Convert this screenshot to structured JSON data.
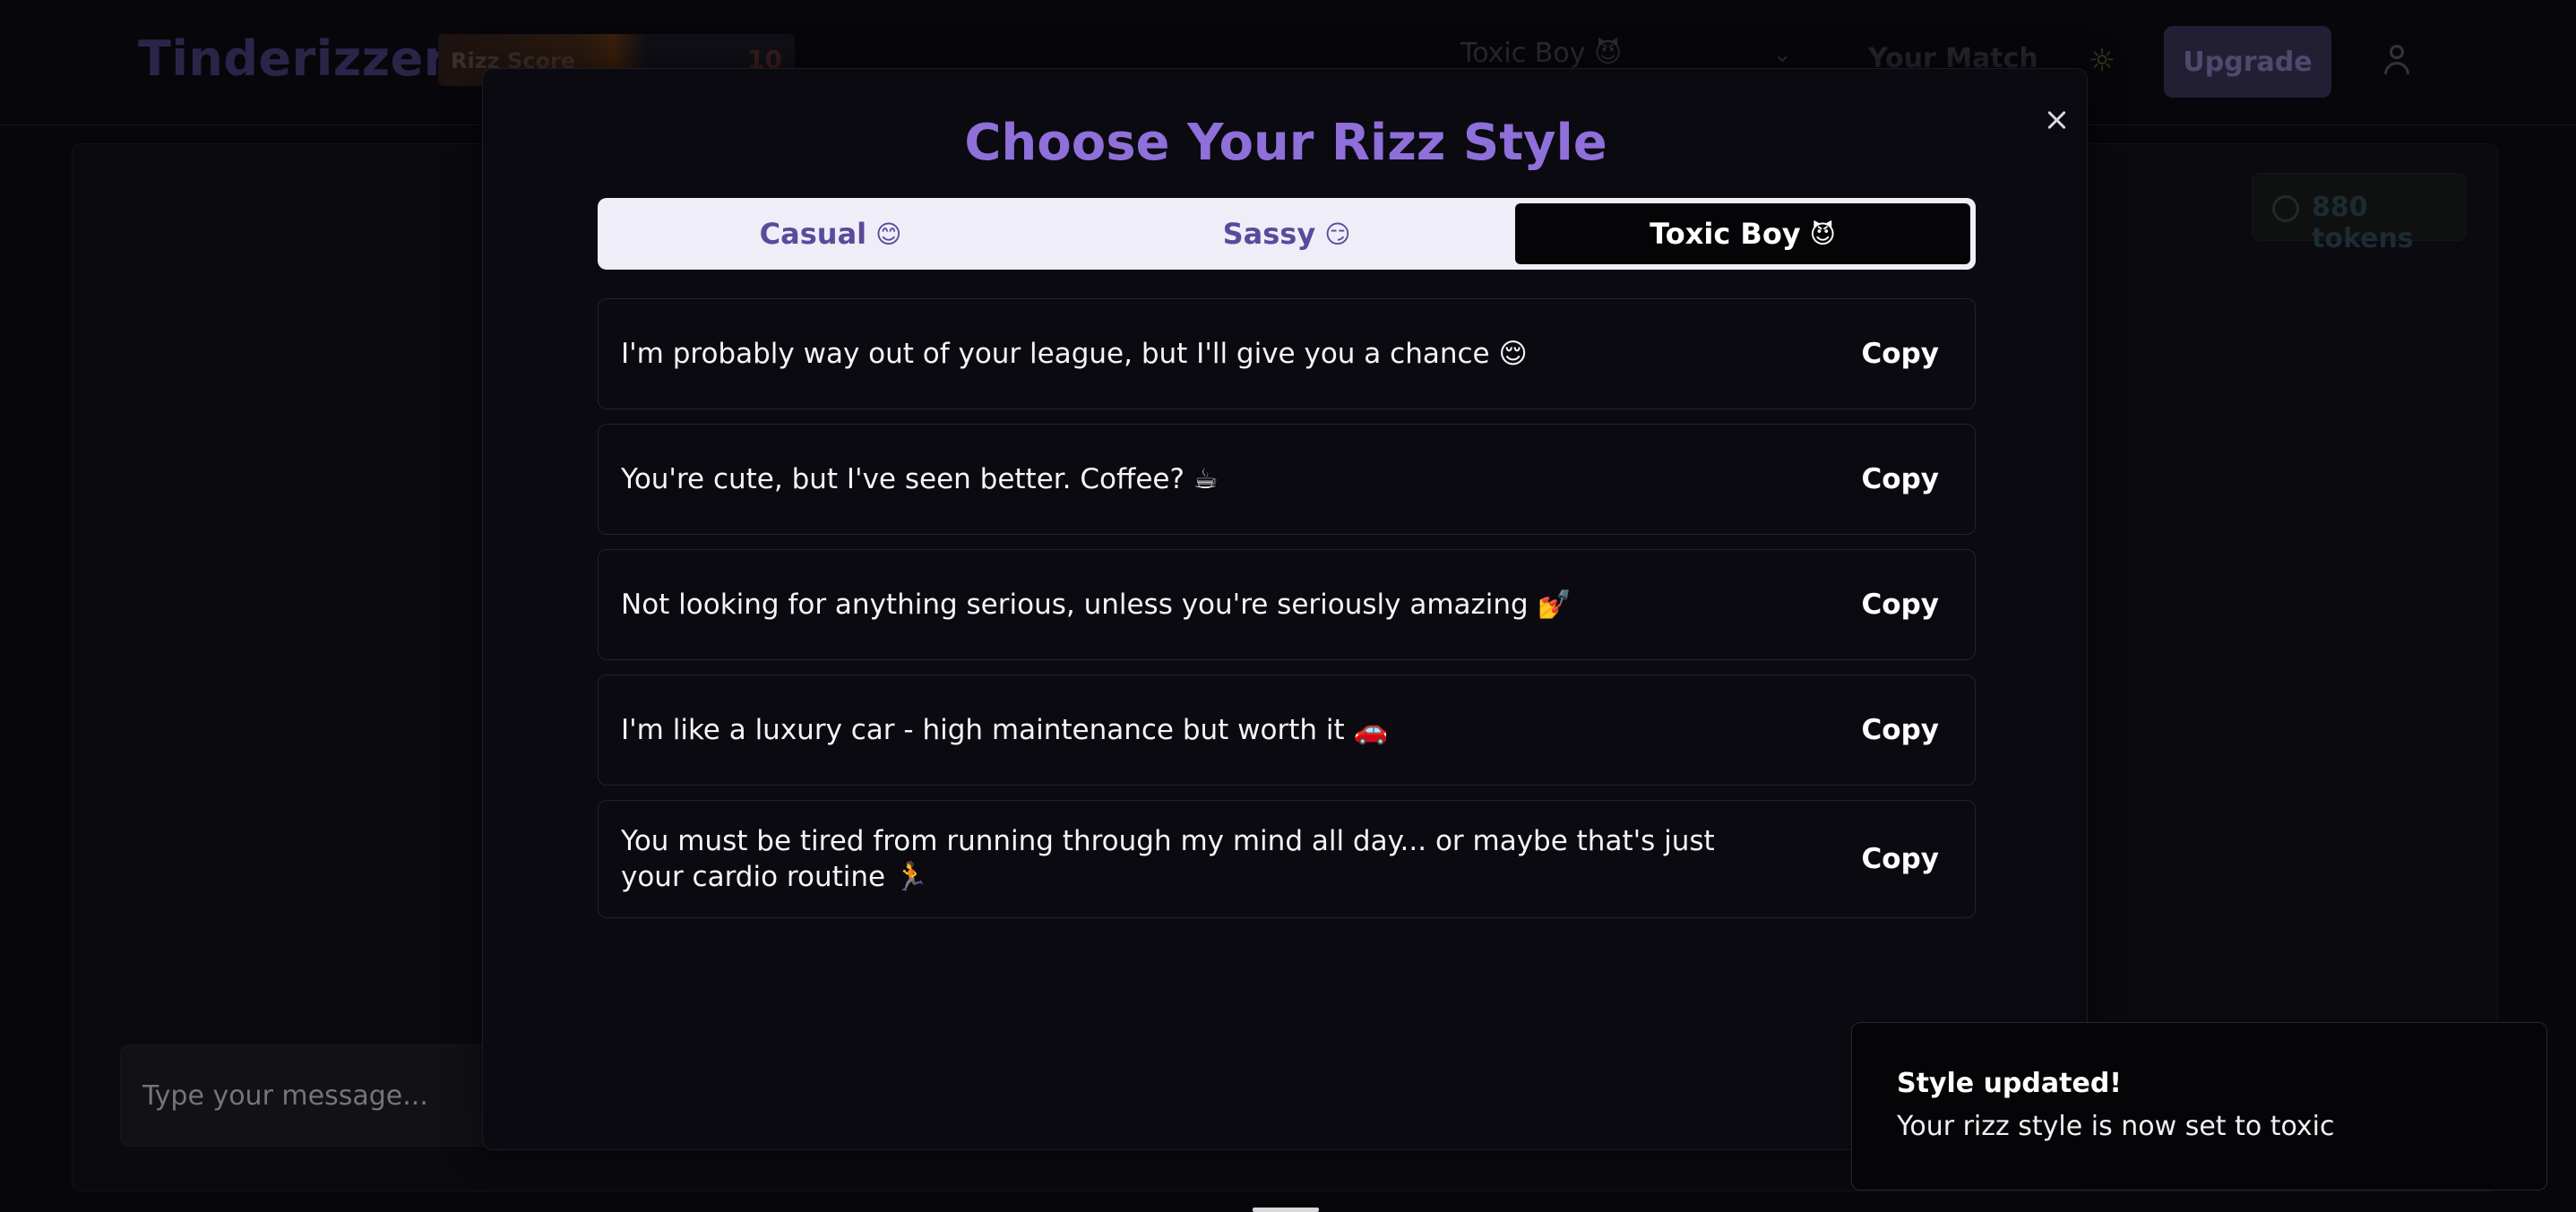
{
  "header": {
    "logo": "Tinderizzer",
    "rizz_score_label": "Rizz Score",
    "rizz_score_value": "10",
    "rizz_score_fill_fraction": 0.58,
    "style_select_value": "Toxic Boy 😈",
    "your_match": "Your Match",
    "upgrade_label": "Upgrade"
  },
  "panel": {
    "tokens": "880 tokens",
    "message_placeholder": "Type your message..."
  },
  "modal": {
    "title": "Choose Your Rizz Style",
    "tabs": [
      {
        "label": "Casual",
        "emoji": "😊"
      },
      {
        "label": "Sassy",
        "emoji": "😏"
      },
      {
        "label": "Toxic Boy",
        "emoji": "😈"
      }
    ],
    "active_tab": "Toxic Boy",
    "copy_label": "Copy",
    "lines": [
      "I'm probably way out of your league, but I'll give you a chance 😌",
      "You're cute, but I've seen better. Coffee? ☕",
      "Not looking for anything serious, unless you're seriously amazing 💅",
      "I'm like a luxury car - high maintenance but worth it 🚗",
      "You must be tired from running through my mind all day... or maybe that's just your cardio routine 🏃"
    ]
  },
  "toast": {
    "title": "Style updated!",
    "body": "Your rizz style is now set to toxic"
  },
  "colors": {
    "accent": "#8f6fd9",
    "tab_bg": "#efedf8",
    "active_tab_bg": "#050508",
    "background": "#07070b"
  }
}
